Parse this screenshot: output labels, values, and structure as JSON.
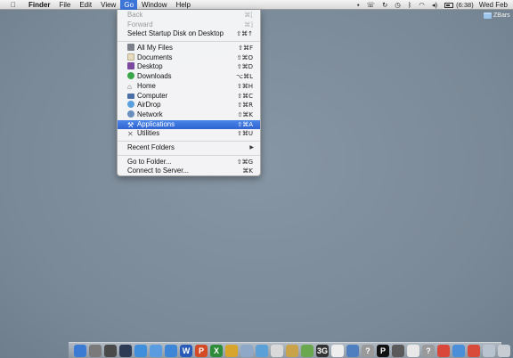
{
  "menubar": {
    "app_name": "Finder",
    "menus": [
      "File",
      "Edit",
      "View",
      "Go",
      "Window",
      "Help"
    ],
    "active_menu": "Go",
    "status": {
      "battery_time": "(6:38)",
      "clock": "Wed Feb"
    }
  },
  "desktop": {
    "item_label": "ZBars"
  },
  "go_menu": {
    "back": {
      "label": "Back",
      "shortcut": "⌘["
    },
    "forward": {
      "label": "Forward",
      "shortcut": "⌘]"
    },
    "startup": {
      "label": "Select Startup Disk on Desktop",
      "shortcut": "⇧⌘↑"
    },
    "places": [
      {
        "label": "All My Files",
        "shortcut": "⇧⌘F",
        "icon": "all-files-icon",
        "color": "#7a7f8a"
      },
      {
        "label": "Documents",
        "shortcut": "⇧⌘O",
        "icon": "documents-icon",
        "color": "#e8dcc0"
      },
      {
        "label": "Desktop",
        "shortcut": "⇧⌘D",
        "icon": "desktop-icon",
        "color": "#7b4aa0"
      },
      {
        "label": "Downloads",
        "shortcut": "⌥⌘L",
        "icon": "downloads-icon",
        "color": "#3aa64a"
      },
      {
        "label": "Home",
        "shortcut": "⇧⌘H",
        "icon": "home-icon",
        "color": "#555555"
      },
      {
        "label": "Computer",
        "shortcut": "⇧⌘C",
        "icon": "computer-icon",
        "color": "#4a6fa6"
      },
      {
        "label": "AirDrop",
        "shortcut": "⇧⌘R",
        "icon": "airdrop-icon",
        "color": "#5aa0e0"
      },
      {
        "label": "Network",
        "shortcut": "⇧⌘K",
        "icon": "network-icon",
        "color": "#6a8fbf"
      },
      {
        "label": "Applications",
        "shortcut": "⇧⌘A",
        "icon": "applications-icon",
        "color": "#d9d9d9"
      },
      {
        "label": "Utilities",
        "shortcut": "⇧⌘U",
        "icon": "utilities-icon",
        "color": "#888888"
      }
    ],
    "recent_folders": {
      "label": "Recent Folders"
    },
    "go_to_folder": {
      "label": "Go to Folder...",
      "shortcut": "⇧⌘G"
    },
    "connect_server": {
      "label": "Connect to Server...",
      "shortcut": "⌘K"
    }
  },
  "dock": {
    "items": [
      {
        "name": "finder-icon",
        "color": "#3b7bd4",
        "glyph": ""
      },
      {
        "name": "launchpad-icon",
        "color": "#7a7a7a",
        "glyph": ""
      },
      {
        "name": "mission-control-icon",
        "color": "#4a4a4a",
        "glyph": ""
      },
      {
        "name": "dashboard-icon",
        "color": "#2d3b55",
        "glyph": ""
      },
      {
        "name": "safari-icon",
        "color": "#3f8fdc",
        "glyph": ""
      },
      {
        "name": "itunes-icon",
        "color": "#5b9be0",
        "glyph": ""
      },
      {
        "name": "app-store-icon",
        "color": "#3d86d8",
        "glyph": ""
      },
      {
        "name": "word-icon",
        "color": "#2a5bb8",
        "glyph": "W"
      },
      {
        "name": "powerpoint-icon",
        "color": "#d24b26",
        "glyph": "P"
      },
      {
        "name": "excel-icon",
        "color": "#2e8b3a",
        "glyph": "X"
      },
      {
        "name": "messenger-icon",
        "color": "#d8a52c",
        "glyph": ""
      },
      {
        "name": "preview-icon",
        "color": "#8fa8c8",
        "glyph": ""
      },
      {
        "name": "photo-icon",
        "color": "#5ca0d8",
        "glyph": ""
      },
      {
        "name": "textedit-icon",
        "color": "#d9d9d9",
        "glyph": ""
      },
      {
        "name": "photos-icon",
        "color": "#c9a34a",
        "glyph": ""
      },
      {
        "name": "maps-icon",
        "color": "#6aa84f",
        "glyph": ""
      },
      {
        "name": "3g-modem-icon",
        "color": "#333333",
        "glyph": "3G"
      },
      {
        "name": "calendar-icon",
        "color": "#eeeeee",
        "glyph": ""
      },
      {
        "name": "xcode-icon",
        "color": "#4f7fbf",
        "glyph": ""
      },
      {
        "name": "help-icon",
        "color": "#9a9a9a",
        "glyph": "?"
      },
      {
        "name": "pages-icon",
        "color": "#111111",
        "glyph": "P"
      },
      {
        "name": "system-prefs-icon",
        "color": "#5a5a5a",
        "glyph": ""
      },
      {
        "name": "notes-icon",
        "color": "#e8e8e8",
        "glyph": ""
      },
      {
        "name": "help-2-icon",
        "color": "#9a9a9a",
        "glyph": "?"
      },
      {
        "name": "chrome-icon",
        "color": "#d9473b",
        "glyph": ""
      },
      {
        "name": "mail-icon",
        "color": "#4a8fd8",
        "glyph": ""
      },
      {
        "name": "stickies-icon",
        "color": "#d84a3a",
        "glyph": ""
      },
      {
        "name": "downloads-stack-icon",
        "color": "#b9c3cf",
        "glyph": ""
      },
      {
        "name": "trash-icon",
        "color": "#c7ccd2",
        "glyph": ""
      }
    ]
  },
  "colors": {
    "menu_highlight": "#3c76d9",
    "desktop": "#7f8e9c"
  }
}
